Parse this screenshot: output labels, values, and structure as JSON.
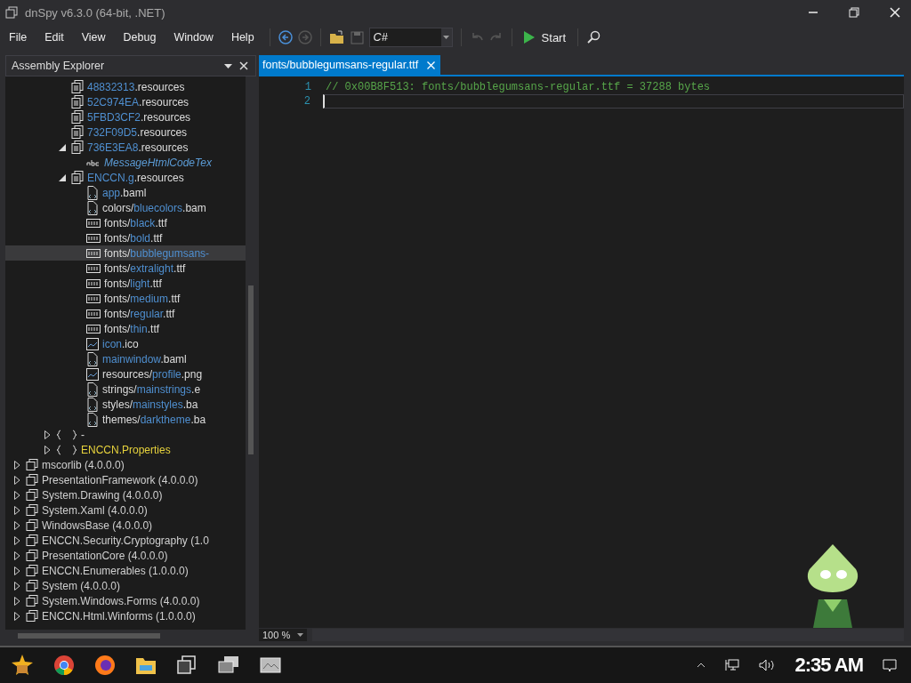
{
  "window": {
    "title": "dnSpy v6.3.0 (64-bit, .NET)"
  },
  "menu": [
    "File",
    "Edit",
    "View",
    "Debug",
    "Window",
    "Help"
  ],
  "toolbar": {
    "language": "C#",
    "start": "Start"
  },
  "explorer": {
    "title": "Assembly Explorer",
    "tree": [
      {
        "children": [
          {
            "children": [
              {
                "children": [
                  {
                    "kind": "resources",
                    "name": "48832313",
                    "suffix": ".resources",
                    "selected": false
                  },
                  {
                    "kind": "resources",
                    "name": "52C974EA",
                    "suffix": ".resources",
                    "selected": false
                  },
                  {
                    "kind": "resources",
                    "name": "5FBD3CF2",
                    "suffix": ".resources",
                    "selected": false
                  },
                  {
                    "kind": "resources",
                    "name": "732F09D5",
                    "suffix": ".resources",
                    "selected": false
                  },
                  {
                    "kind": "resources",
                    "name": "736E3EA8",
                    "suffix": ".resources",
                    "expanded": true,
                    "selected": false,
                    "children": [
                      {
                        "kind": "string",
                        "name": "MessageHtmlCodeTex",
                        "selected": false
                      }
                    ]
                  },
                  {
                    "kind": "resources",
                    "name": "ENCCN.g",
                    "suffix": ".resources",
                    "expanded": true,
                    "selected": false,
                    "children": [
                      {
                        "kind": "baml",
                        "name": "app",
                        "suffix": ".baml",
                        "selected": false
                      },
                      {
                        "kind": "baml",
                        "prefix": "colors/",
                        "name": "bluecolors",
                        "suffix": ".bam",
                        "selected": false
                      },
                      {
                        "kind": "binary",
                        "prefix": "fonts/",
                        "name": "black",
                        "suffix": ".ttf",
                        "selected": false
                      },
                      {
                        "kind": "binary",
                        "prefix": "fonts/",
                        "name": "bold",
                        "suffix": ".ttf",
                        "selected": false
                      },
                      {
                        "kind": "binary",
                        "prefix": "fonts/",
                        "name": "bubblegumsans-",
                        "selected": true
                      },
                      {
                        "kind": "binary",
                        "prefix": "fonts/",
                        "name": "extralight",
                        "suffix": ".ttf",
                        "selected": false
                      },
                      {
                        "kind": "binary",
                        "prefix": "fonts/",
                        "name": "light",
                        "suffix": ".ttf",
                        "selected": false
                      },
                      {
                        "kind": "binary",
                        "prefix": "fonts/",
                        "name": "medium",
                        "suffix": ".ttf",
                        "selected": false
                      },
                      {
                        "kind": "binary",
                        "prefix": "fonts/",
                        "name": "regular",
                        "suffix": ".ttf",
                        "selected": false
                      },
                      {
                        "kind": "binary",
                        "prefix": "fonts/",
                        "name": "thin",
                        "suffix": ".ttf",
                        "selected": false
                      },
                      {
                        "kind": "image",
                        "name": "icon",
                        "suffix": ".ico",
                        "selected": false
                      },
                      {
                        "kind": "baml",
                        "name": "mainwindow",
                        "suffix": ".baml",
                        "selected": false
                      },
                      {
                        "kind": "image",
                        "prefix": "resources/",
                        "name": "profile",
                        "suffix": ".png",
                        "selected": false
                      },
                      {
                        "kind": "baml",
                        "prefix": "strings/",
                        "name": "mainstrings",
                        "suffix": ".e",
                        "selected": false
                      },
                      {
                        "kind": "baml",
                        "prefix": "styles/",
                        "name": "mainstyles",
                        "suffix": ".ba",
                        "selected": false
                      },
                      {
                        "kind": "baml",
                        "prefix": "themes/",
                        "name": "darktheme",
                        "suffix": ".ba",
                        "selected": false
                      }
                    ]
                  }
                ]
              },
              {
                "kind": "namespace",
                "prefix": "-",
                "expanded": false,
                "selected": false
              },
              {
                "kind": "namespace",
                "name": "ENCCN.Properties",
                "expanded": false,
                "selected": false
              }
            ]
          }
        ]
      },
      {
        "kind": "assembly",
        "prefix": "mscorlib (4.0.0.0)",
        "expanded": false,
        "selected": false
      },
      {
        "kind": "assembly",
        "prefix": "PresentationFramework (4.0.0.0)",
        "expanded": false,
        "selected": false
      },
      {
        "kind": "assembly",
        "prefix": "System.Drawing (4.0.0.0)",
        "expanded": false,
        "selected": false
      },
      {
        "kind": "assembly",
        "prefix": "System.Xaml (4.0.0.0)",
        "expanded": false,
        "selected": false
      },
      {
        "kind": "assembly",
        "prefix": "WindowsBase (4.0.0.0)",
        "expanded": false,
        "selected": false
      },
      {
        "kind": "assembly",
        "prefix": "ENCCN.Security.Cryptography (1.0",
        "expanded": false,
        "selected": false
      },
      {
        "kind": "assembly",
        "prefix": "PresentationCore (4.0.0.0)",
        "expanded": false,
        "selected": false
      },
      {
        "kind": "assembly",
        "prefix": "ENCCN.Enumerables (1.0.0.0)",
        "expanded": false,
        "selected": false
      },
      {
        "kind": "assembly",
        "prefix": "System (4.0.0.0)",
        "expanded": false,
        "selected": false
      },
      {
        "kind": "assembly",
        "prefix": "System.Windows.Forms (4.0.0.0)",
        "expanded": false,
        "selected": false
      },
      {
        "kind": "assembly",
        "prefix": "ENCCN.Html.Winforms (1.0.0.0)",
        "expanded": false,
        "selected": false
      }
    ]
  },
  "editor": {
    "tabs": [
      {
        "label": "fonts/bubblegumsans-regular.ttf",
        "selected": true
      }
    ],
    "lines": [
      {
        "number": "1",
        "code": "// 0x00B8F513: fonts/bubblegumsans-regular.ttf = 37288 bytes"
      },
      {
        "number": "2"
      }
    ],
    "zoom": "100 %"
  },
  "taskbar": {
    "clock": "2:35 AM"
  }
}
